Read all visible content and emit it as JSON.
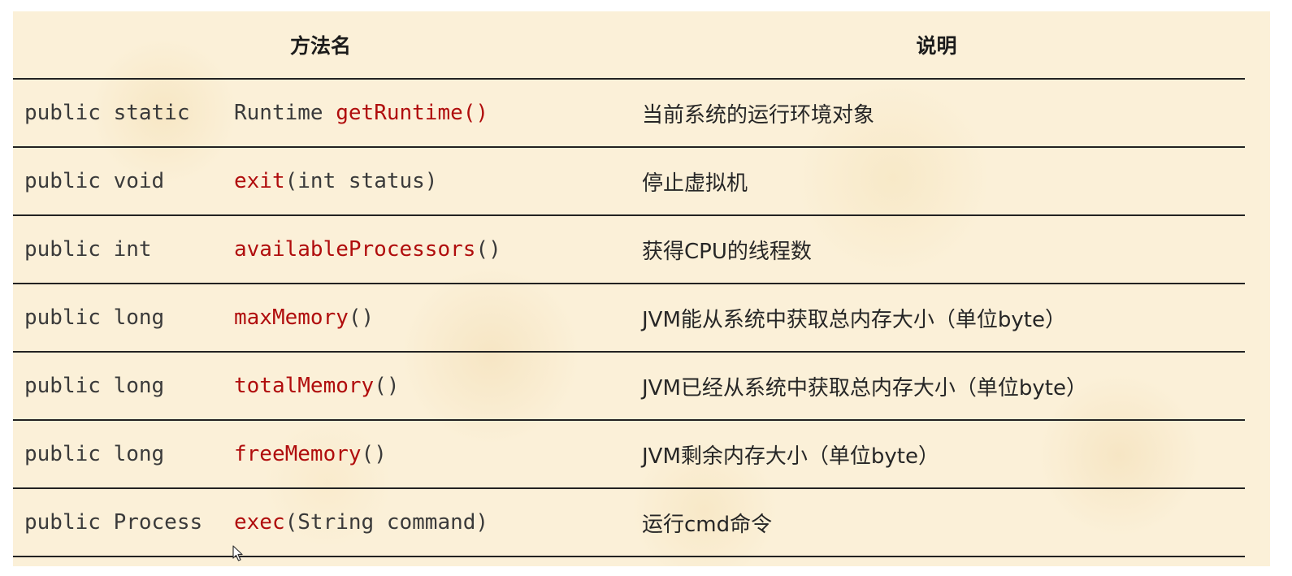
{
  "table": {
    "headers": {
      "method": "方法名",
      "description": "说明"
    },
    "rows": [
      {
        "modifiers": "public static",
        "return_type": "Runtime",
        "method_name": "getRuntime()",
        "params": "",
        "description": "当前系统的运行环境对象"
      },
      {
        "modifiers": "public void",
        "return_type": "",
        "method_name": "exit",
        "params": "(int status)",
        "description": "停止虚拟机"
      },
      {
        "modifiers": "public int",
        "return_type": "",
        "method_name": "availableProcessors",
        "params": "()",
        "description": "获得CPU的线程数"
      },
      {
        "modifiers": "public long",
        "return_type": "",
        "method_name": "maxMemory",
        "params": "()",
        "description": "JVM能从系统中获取总内存大小（单位byte）"
      },
      {
        "modifiers": "public long",
        "return_type": "",
        "method_name": "totalMemory",
        "params": "()",
        "description": "JVM已经从系统中获取总内存大小（单位byte）"
      },
      {
        "modifiers": "public long",
        "return_type": "",
        "method_name": "freeMemory",
        "params": "()",
        "description": "JVM剩余内存大小（单位byte）"
      },
      {
        "modifiers": "public Process",
        "return_type": "",
        "method_name": "exec",
        "params": "(String command)",
        "description": "运行cmd命令"
      }
    ]
  },
  "colors": {
    "method_name": "#b00d0d",
    "code_text": "#3a3a3a",
    "background": "#fbf0d8",
    "rule": "#222222"
  },
  "icons": {
    "cursor": "mouse-pointer-icon"
  }
}
